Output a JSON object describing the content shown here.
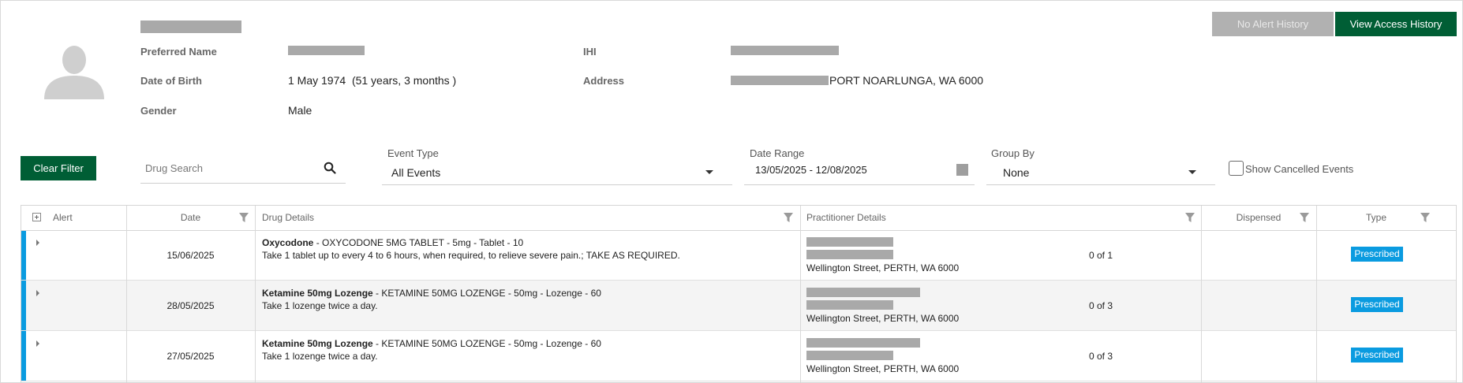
{
  "colors": {
    "primary_green": "#005e35",
    "disabled_gray": "#b1b1b1",
    "prescribed_blue": "#0a9be0",
    "redaction_gray": "#a9a9a9"
  },
  "header": {
    "alert_history_label": "No Alert History",
    "access_history_label": "View Access History"
  },
  "patient": {
    "preferred_name_label": "Preferred Name",
    "dob_label": "Date of Birth",
    "dob_value": "1 May 1974  (51 years, 3 months )",
    "gender_label": "Gender",
    "gender_value": "Male",
    "ihi_label": "IHI",
    "address_label": "Address",
    "address_value": "PORT NOARLUNGA, WA 6000"
  },
  "filters": {
    "clear_label": "Clear Filter",
    "drug_search_placeholder": "Drug Search",
    "event_type_label": "Event Type",
    "event_type_value": "All Events",
    "date_range_label": "Date Range",
    "date_range_value": "13/05/2025 - 12/08/2025",
    "group_by_label": "Group By",
    "group_by_value": "None",
    "show_cancelled_label": "Show Cancelled Events"
  },
  "table": {
    "columns": {
      "alert": "Alert",
      "date": "Date",
      "drug_details": "Drug Details",
      "practitioner_details": "Practitioner Details",
      "dispensed": "Dispensed",
      "type": "Type"
    },
    "rows": [
      {
        "date": "15/06/2025",
        "drug_name": "Oxycodone",
        "drug_desc": " - OXYCODONE 5MG TABLET - 5mg - Tablet - 10",
        "instructions": "Take 1 tablet up to every 4 to 6 hours, when required, to relieve severe pain.; TAKE AS REQUIRED.",
        "practitioner_address": "Wellington Street, PERTH, WA 6000",
        "dispensed": "0 of 1",
        "type": "Prescribed"
      },
      {
        "date": "28/05/2025",
        "drug_name": "Ketamine 50mg Lozenge",
        "drug_desc": " - KETAMINE 50MG LOZENGE - 50mg - Lozenge - 60",
        "instructions": "Take 1 lozenge twice a day.",
        "practitioner_address": "Wellington Street, PERTH, WA 6000",
        "dispensed": "0 of 3",
        "type": "Prescribed"
      },
      {
        "date": "27/05/2025",
        "drug_name": "Ketamine 50mg Lozenge",
        "drug_desc": " - KETAMINE 50MG LOZENGE - 50mg - Lozenge - 60",
        "instructions": "Take 1 lozenge twice a day.",
        "practitioner_address": "Wellington Street, PERTH, WA 6000",
        "dispensed": "0 of 3",
        "type": "Prescribed"
      }
    ]
  }
}
